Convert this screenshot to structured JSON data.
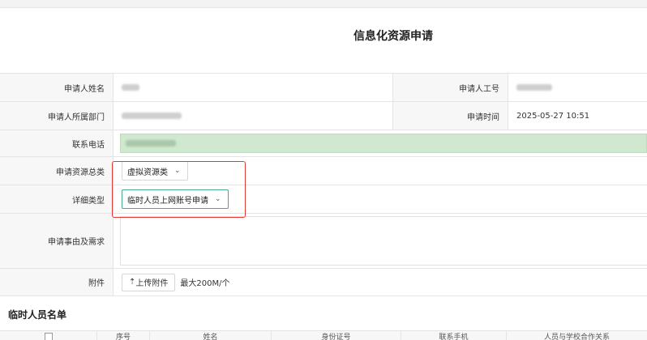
{
  "title": "信息化资源申请",
  "form": {
    "applicant_name": {
      "label": "申请人姓名",
      "value": ""
    },
    "applicant_id": {
      "label": "申请人工号",
      "value": ""
    },
    "department": {
      "label": "申请人所属部门",
      "value": ""
    },
    "apply_time": {
      "label": "申请时间",
      "value": "2025-05-27 10:51"
    },
    "phone": {
      "label": "联系电话",
      "value": ""
    },
    "resource_category": {
      "label": "申请资源总类",
      "selected": "虚拟资源类"
    },
    "detail_type": {
      "label": "详细类型",
      "selected": "临时人员上网账号申请"
    },
    "reason": {
      "label": "申请事由及需求",
      "value": ""
    },
    "attachment": {
      "label": "附件",
      "button": "上传附件",
      "hint": "最大200M/个"
    }
  },
  "list": {
    "section_title": "临时人员名单",
    "columns": [
      "",
      "序号",
      "姓名",
      "身份证号",
      "联系手机",
      "人员与学校合作关系"
    ]
  },
  "colors": {
    "highlight_border": "#e53935",
    "green_field": "#cfe8cf",
    "active_select": "#4aa98a"
  }
}
